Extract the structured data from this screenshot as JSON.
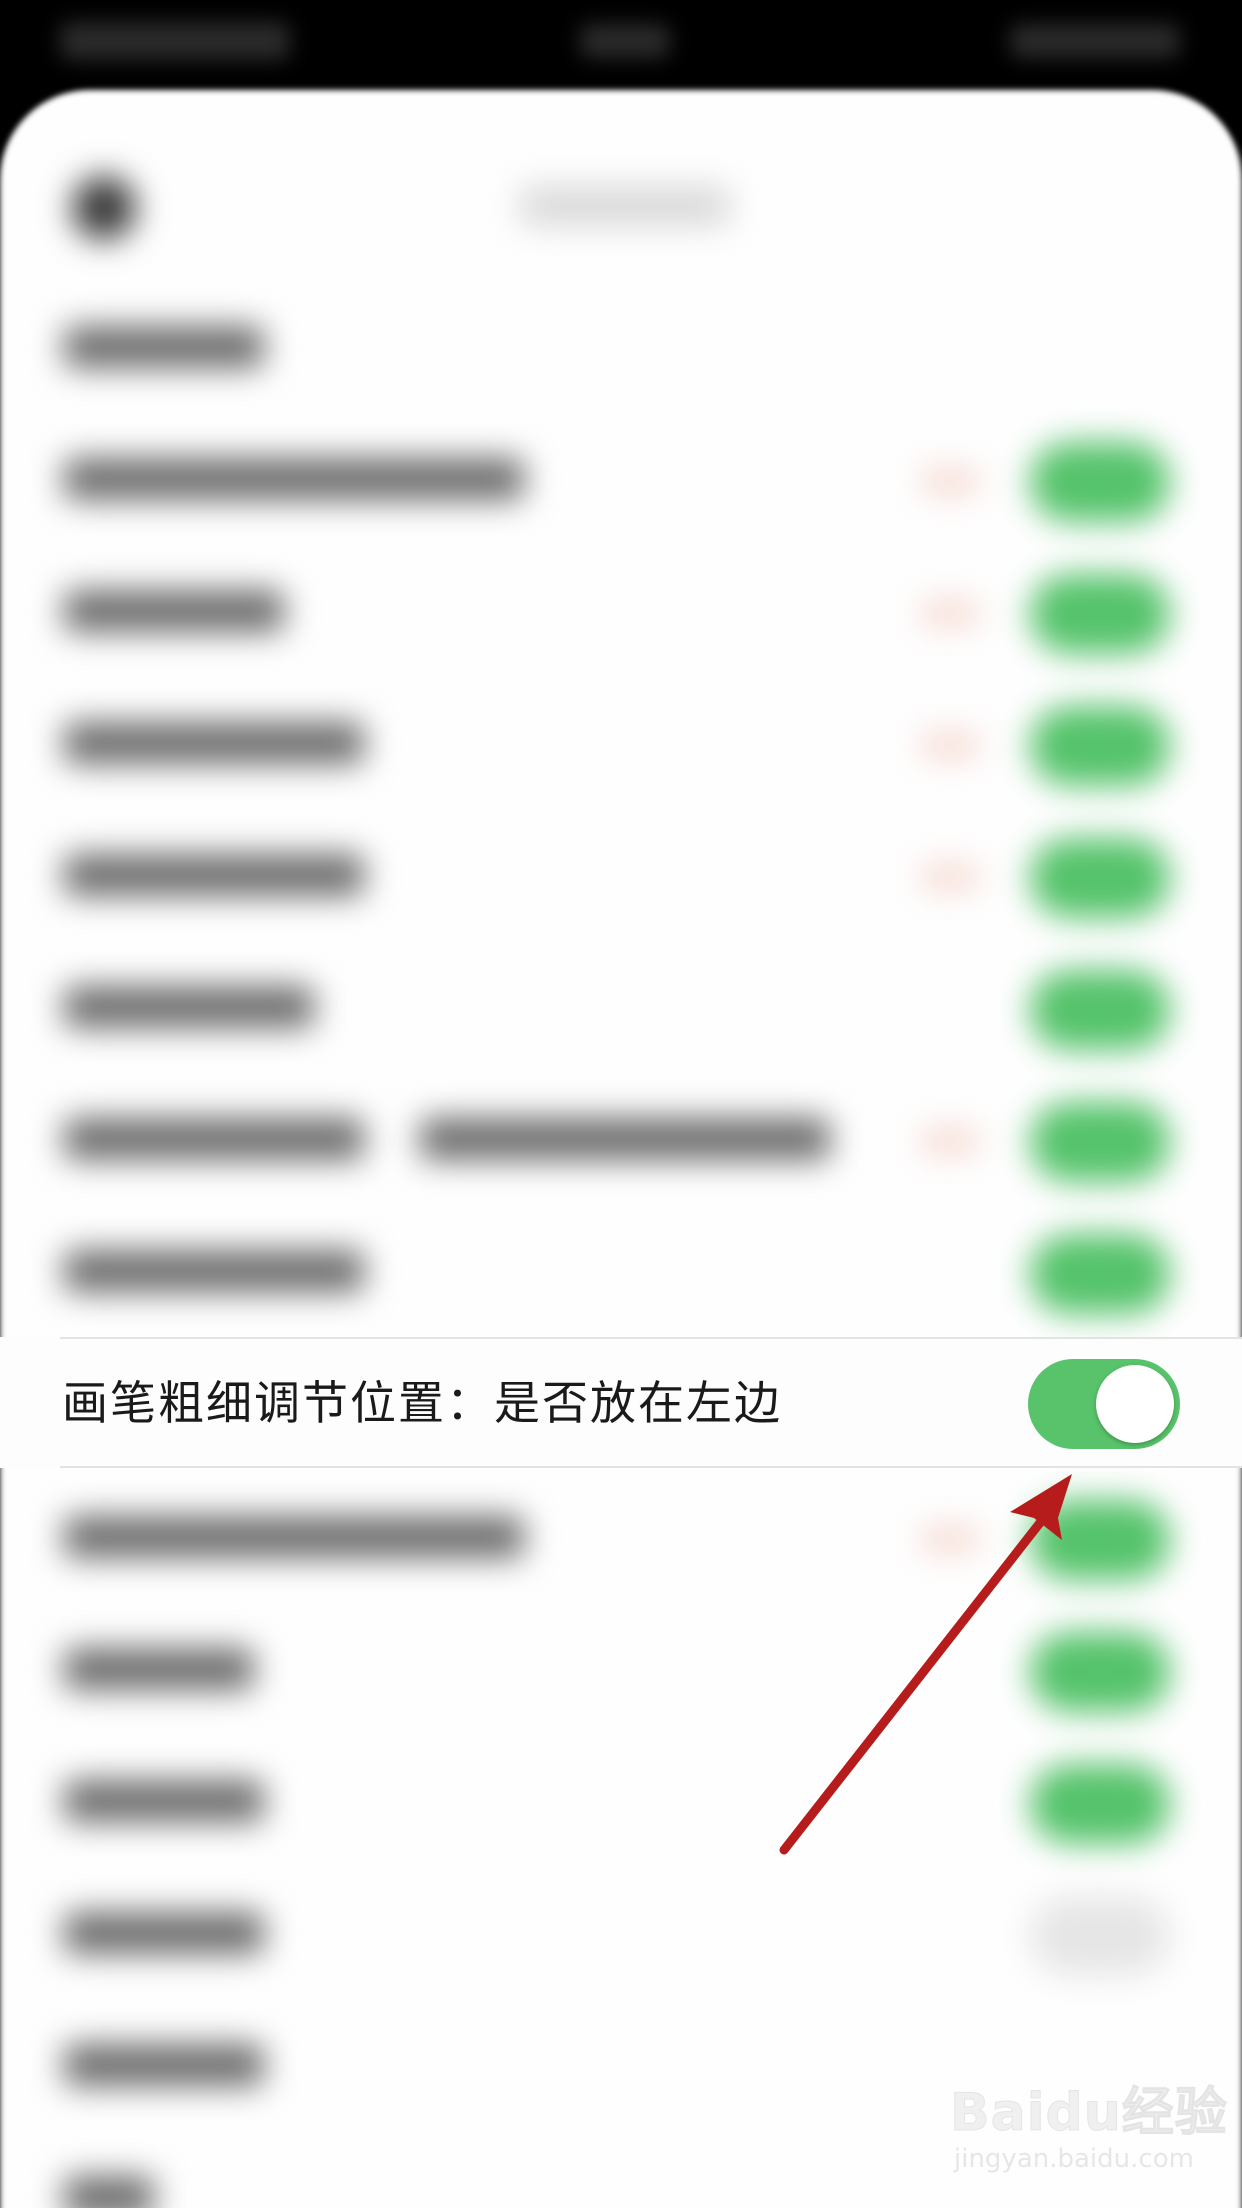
{
  "settings": {
    "highlighted_row": {
      "label": "画笔粗细调节位置：是否放在左边",
      "toggle_state": "on",
      "toggle_color": "#58c36a"
    }
  },
  "watermark": {
    "logo": "Baidu经验",
    "url": "jingyan.baidu.com"
  },
  "annotation": {
    "arrow_color": "#b71c1c"
  },
  "colors": {
    "toggle_on": "#58c36a",
    "background": "#fefefe"
  }
}
